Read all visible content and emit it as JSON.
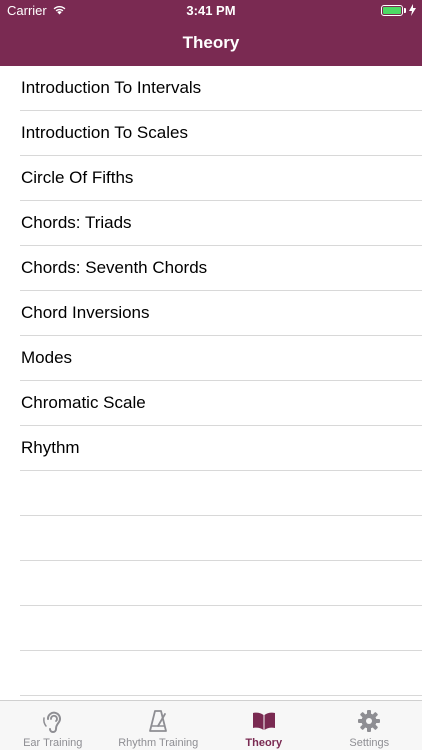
{
  "status_bar": {
    "carrier": "Carrier",
    "time": "3:41 PM"
  },
  "nav": {
    "title": "Theory"
  },
  "rows": [
    "Introduction To Intervals",
    "Introduction To Scales",
    "Circle Of Fifths",
    "Chords: Triads",
    "Chords: Seventh Chords",
    "Chord Inversions",
    "Modes",
    "Chromatic Scale",
    "Rhythm"
  ],
  "tabbar": {
    "items": [
      {
        "label": "Ear Training",
        "icon": "ear-icon"
      },
      {
        "label": "Rhythm Training",
        "icon": "metronome-icon"
      },
      {
        "label": "Theory",
        "icon": "open-book-icon",
        "active": true
      },
      {
        "label": "Settings",
        "icon": "gear-icon"
      }
    ]
  },
  "colors": {
    "accent": "#7a2a52",
    "inactive": "#8e8e93",
    "battery": "#4cd964"
  }
}
